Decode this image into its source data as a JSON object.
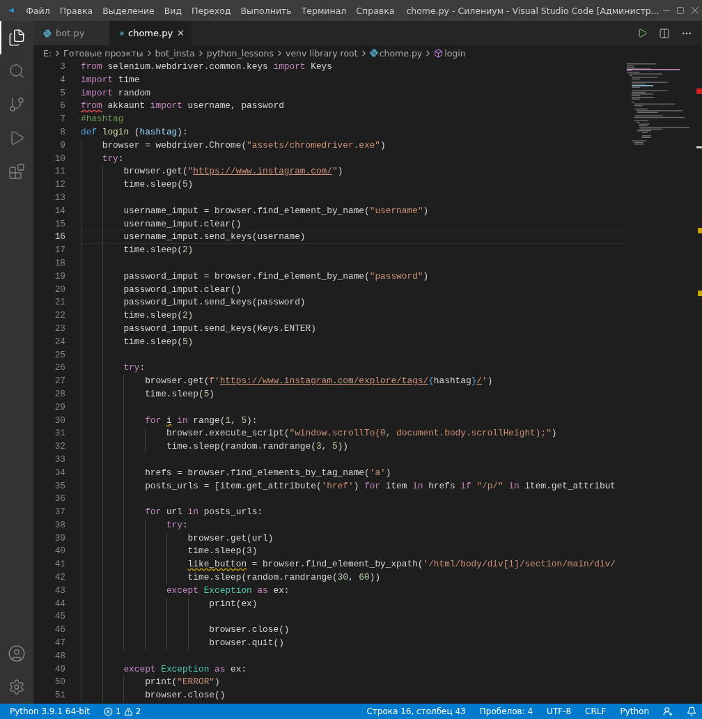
{
  "window": {
    "title": "chome.py - Силениум - Visual Studio Code [Администр..."
  },
  "menu": [
    "Файл",
    "Правка",
    "Выделение",
    "Вид",
    "Переход",
    "Выполнить",
    "Терминал",
    "Справка"
  ],
  "tabs": [
    {
      "label": "bot.py",
      "selected": false
    },
    {
      "label": "chome.py",
      "selected": true,
      "close": "✕"
    }
  ],
  "breadcrumb": [
    {
      "label": "E:",
      "kind": "folder"
    },
    {
      "label": "Готовые проэкты",
      "kind": "folder"
    },
    {
      "label": "bot_insta",
      "kind": "folder"
    },
    {
      "label": "python_lessons",
      "kind": "folder"
    },
    {
      "label": "venv library root",
      "kind": "folder"
    },
    {
      "label": "chome.py",
      "kind": "file"
    },
    {
      "label": "login",
      "kind": "symbol"
    }
  ],
  "lines": [
    {
      "n": "3",
      "current": false,
      "tokens": [
        {
          "t": "from",
          "kind": "keyword"
        },
        {
          "t": " selenium.webdriver.common.keys ",
          "kind": "plain"
        },
        {
          "t": "import",
          "kind": "keyword"
        },
        {
          "t": " Keys",
          "kind": "plain"
        }
      ]
    },
    {
      "n": "4",
      "current": false,
      "tokens": [
        {
          "t": "import",
          "kind": "keyword"
        },
        {
          "t": " time",
          "kind": "plain"
        }
      ]
    },
    {
      "n": "5",
      "current": false,
      "tokens": [
        {
          "t": "import",
          "kind": "keyword"
        },
        {
          "t": " random",
          "kind": "plain"
        }
      ]
    },
    {
      "n": "6",
      "current": false,
      "tokens": [
        {
          "t": "from",
          "kind": "keyword",
          "error": true
        },
        {
          "t": " akkaunt ",
          "kind": "plain"
        },
        {
          "t": "import",
          "kind": "keyword"
        },
        {
          "t": " username, password",
          "kind": "plain"
        }
      ]
    },
    {
      "n": "7",
      "current": false,
      "tokens": [
        {
          "t": "#hashtag",
          "kind": "comment"
        }
      ]
    },
    {
      "n": "8",
      "current": false,
      "tokens": [
        {
          "t": "def",
          "kind": "storage"
        },
        {
          "t": " login",
          "kind": "function"
        },
        {
          "t": " (",
          "kind": "plain"
        },
        {
          "t": "hashtag",
          "kind": "parameter"
        },
        {
          "t": "):",
          "kind": "plain"
        }
      ]
    },
    {
      "n": "9",
      "current": false,
      "tokens": [
        {
          "t": "    browser = webdriver.Chrome(",
          "kind": "plain"
        },
        {
          "t": "\"assets/chromedriver.exe\"",
          "kind": "string"
        },
        {
          "t": ")",
          "kind": "plain"
        }
      ]
    },
    {
      "n": "10",
      "current": false,
      "tokens": [
        {
          "t": "    try",
          "kind": "keyword"
        },
        {
          "t": ":",
          "kind": "plain"
        }
      ]
    },
    {
      "n": "11",
      "current": false,
      "tokens": [
        {
          "t": "        browser.get(",
          "kind": "plain"
        },
        {
          "t": "\"",
          "kind": "string"
        },
        {
          "t": "https://www.instagram.com/",
          "kind": "link"
        },
        {
          "t": "\"",
          "kind": "string"
        },
        {
          "t": ")",
          "kind": "plain"
        }
      ]
    },
    {
      "n": "12",
      "current": false,
      "tokens": [
        {
          "t": "        time.sleep(",
          "kind": "plain"
        },
        {
          "t": "5",
          "kind": "number"
        },
        {
          "t": ")",
          "kind": "plain"
        }
      ]
    },
    {
      "n": "13",
      "current": false
    },
    {
      "n": "14",
      "current": false,
      "tokens": [
        {
          "t": "        username_imput = browser.find_element_by_name(",
          "kind": "plain"
        },
        {
          "t": "\"username\"",
          "kind": "string"
        },
        {
          "t": ")",
          "kind": "plain"
        }
      ]
    },
    {
      "n": "15",
      "current": false,
      "tokens": [
        {
          "t": "        username_imput.clear()",
          "kind": "plain"
        }
      ]
    },
    {
      "n": "16",
      "current": true,
      "tokens": [
        {
          "t": "        username_imput.send_keys(username)",
          "kind": "plain"
        }
      ]
    },
    {
      "n": "17",
      "current": false,
      "tokens": [
        {
          "t": "        time.sleep(",
          "kind": "plain"
        },
        {
          "t": "2",
          "kind": "number"
        },
        {
          "t": ")",
          "kind": "plain"
        }
      ]
    },
    {
      "n": "18",
      "current": false
    },
    {
      "n": "19",
      "current": false,
      "tokens": [
        {
          "t": "        password_imput = browser.find_element_by_name(",
          "kind": "plain"
        },
        {
          "t": "\"password\"",
          "kind": "string"
        },
        {
          "t": ")",
          "kind": "plain"
        }
      ]
    },
    {
      "n": "20",
      "current": false,
      "tokens": [
        {
          "t": "        password_imput.clear()",
          "kind": "plain"
        }
      ]
    },
    {
      "n": "21",
      "current": false,
      "tokens": [
        {
          "t": "        password_imput.send_keys(password)",
          "kind": "plain"
        }
      ]
    },
    {
      "n": "22",
      "current": false,
      "tokens": [
        {
          "t": "        time.sleep(",
          "kind": "plain"
        },
        {
          "t": "2",
          "kind": "number"
        },
        {
          "t": ")",
          "kind": "plain"
        }
      ]
    },
    {
      "n": "23",
      "current": false,
      "tokens": [
        {
          "t": "        password_imput.send_keys(Keys.ENTER)",
          "kind": "plain"
        }
      ]
    },
    {
      "n": "24",
      "current": false,
      "tokens": [
        {
          "t": "        time.sleep(",
          "kind": "plain"
        },
        {
          "t": "5",
          "kind": "number"
        },
        {
          "t": ")",
          "kind": "plain"
        }
      ]
    },
    {
      "n": "25",
      "current": false
    },
    {
      "n": "26",
      "current": false,
      "tokens": [
        {
          "t": "        try",
          "kind": "keyword"
        },
        {
          "t": ":",
          "kind": "plain"
        }
      ]
    },
    {
      "n": "27",
      "current": false,
      "tokens": [
        {
          "t": "            browser.get(",
          "kind": "plain"
        },
        {
          "t": "f'",
          "kind": "string"
        },
        {
          "t": "https://www.instagram.com/explore/tags/",
          "kind": "link"
        },
        {
          "t": "{",
          "kind": "storage"
        },
        {
          "t": "hashtag",
          "kind": "plain"
        },
        {
          "t": "}",
          "kind": "storage"
        },
        {
          "t": "/",
          "kind": "link"
        },
        {
          "t": "'",
          "kind": "string"
        },
        {
          "t": ")",
          "kind": "plain"
        }
      ]
    },
    {
      "n": "28",
      "current": false,
      "tokens": [
        {
          "t": "            time.sleep(",
          "kind": "plain"
        },
        {
          "t": "5",
          "kind": "number"
        },
        {
          "t": ")",
          "kind": "plain"
        }
      ]
    },
    {
      "n": "29",
      "current": false
    },
    {
      "n": "30",
      "current": false,
      "tokens": [
        {
          "t": "            for ",
          "kind": "keyword"
        },
        {
          "t": "i",
          "kind": "plain",
          "warning": true
        },
        {
          "t": " in",
          "kind": "keyword"
        },
        {
          "t": " range(",
          "kind": "plain"
        },
        {
          "t": "1",
          "kind": "number"
        },
        {
          "t": ", ",
          "kind": "plain"
        },
        {
          "t": "5",
          "kind": "number"
        },
        {
          "t": "):",
          "kind": "plain"
        }
      ]
    },
    {
      "n": "31",
      "current": false,
      "tokens": [
        {
          "t": "                browser.execute_script(",
          "kind": "plain"
        },
        {
          "t": "\"window.scrollTo(0, document.body.scrollHeight);\"",
          "kind": "string"
        },
        {
          "t": ")",
          "kind": "plain"
        }
      ]
    },
    {
      "n": "32",
      "current": false,
      "tokens": [
        {
          "t": "                time.sleep(random.randrange(",
          "kind": "plain"
        },
        {
          "t": "3",
          "kind": "number"
        },
        {
          "t": ", ",
          "kind": "plain"
        },
        {
          "t": "5",
          "kind": "number"
        },
        {
          "t": "))",
          "kind": "plain"
        }
      ]
    },
    {
      "n": "33",
      "current": false
    },
    {
      "n": "34",
      "current": false,
      "tokens": [
        {
          "t": "            hrefs = browser.find_elements_by_tag_name(",
          "kind": "plain"
        },
        {
          "t": "'a'",
          "kind": "string"
        },
        {
          "t": ")",
          "kind": "plain"
        }
      ]
    },
    {
      "n": "35",
      "current": false,
      "tokens": [
        {
          "t": "            posts_urls = [item.get_attribute(",
          "kind": "plain"
        },
        {
          "t": "'href'",
          "kind": "string"
        },
        {
          "t": ") ",
          "kind": "plain"
        },
        {
          "t": "for",
          "kind": "keyword"
        },
        {
          "t": " item ",
          "kind": "plain"
        },
        {
          "t": "in",
          "kind": "keyword"
        },
        {
          "t": " hrefs ",
          "kind": "plain"
        },
        {
          "t": "if ",
          "kind": "keyword"
        },
        {
          "t": "\"/p/\"",
          "kind": "string"
        },
        {
          "t": " in",
          "kind": "keyword"
        },
        {
          "t": " item.get_attribut",
          "kind": "plain"
        }
      ]
    },
    {
      "n": "36",
      "current": false
    },
    {
      "n": "37",
      "current": false,
      "tokens": [
        {
          "t": "            for",
          "kind": "keyword"
        },
        {
          "t": " url ",
          "kind": "plain"
        },
        {
          "t": "in",
          "kind": "keyword"
        },
        {
          "t": " posts_urls:",
          "kind": "plain"
        }
      ]
    },
    {
      "n": "38",
      "current": false,
      "tokens": [
        {
          "t": "                try",
          "kind": "keyword"
        },
        {
          "t": ":",
          "kind": "plain"
        }
      ]
    },
    {
      "n": "39",
      "current": false,
      "tokens": [
        {
          "t": "                    browser.get(url)",
          "kind": "plain"
        }
      ]
    },
    {
      "n": "40",
      "current": false,
      "tokens": [
        {
          "t": "                    time.sleep(",
          "kind": "plain"
        },
        {
          "t": "3",
          "kind": "number"
        },
        {
          "t": ")",
          "kind": "plain"
        }
      ]
    },
    {
      "n": "41",
      "current": false,
      "tokens": [
        {
          "t": "                    like_button",
          "kind": "plain",
          "warning": true
        },
        {
          "t": " = browser.find_element_by_xpath(",
          "kind": "plain"
        },
        {
          "t": "'/html/body/div[1]/section/main/div/",
          "kind": "string"
        }
      ]
    },
    {
      "n": "42",
      "current": false,
      "tokens": [
        {
          "t": "                    time.sleep(random.randrange(",
          "kind": "plain"
        },
        {
          "t": "30",
          "kind": "number"
        },
        {
          "t": ", ",
          "kind": "plain"
        },
        {
          "t": "60",
          "kind": "number"
        },
        {
          "t": "))",
          "kind": "plain"
        }
      ]
    },
    {
      "n": "43",
      "current": false,
      "tokens": [
        {
          "t": "                except ",
          "kind": "keyword"
        },
        {
          "t": "Exception",
          "kind": "class"
        },
        {
          "t": " as",
          "kind": "keyword"
        },
        {
          "t": " ex:",
          "kind": "plain"
        }
      ]
    },
    {
      "n": "44",
      "current": false,
      "tokens": [
        {
          "t": "                        print(ex)",
          "kind": "plain"
        }
      ]
    },
    {
      "n": "45",
      "current": false
    },
    {
      "n": "46",
      "current": false,
      "tokens": [
        {
          "t": "                        browser.close()",
          "kind": "plain"
        }
      ]
    },
    {
      "n": "47",
      "current": false,
      "tokens": [
        {
          "t": "                        browser.quit()",
          "kind": "plain"
        }
      ]
    },
    {
      "n": "48",
      "current": false
    },
    {
      "n": "49",
      "current": false,
      "tokens": [
        {
          "t": "        except ",
          "kind": "keyword"
        },
        {
          "t": "Exception",
          "kind": "class"
        },
        {
          "t": " as",
          "kind": "keyword"
        },
        {
          "t": " ex:",
          "kind": "plain"
        }
      ]
    },
    {
      "n": "50",
      "current": false,
      "tokens": [
        {
          "t": "            print(",
          "kind": "plain"
        },
        {
          "t": "\"ERROR\"",
          "kind": "string"
        },
        {
          "t": ")",
          "kind": "plain"
        }
      ]
    },
    {
      "n": "51",
      "current": false,
      "tokens": [
        {
          "t": "            browser.close()",
          "kind": "plain"
        }
      ]
    }
  ],
  "status_bar": {
    "interpreter": "Python 3.9.1 64-bit",
    "errors": "1",
    "warnings": "2",
    "right": [
      "Строка 16, столбец 43",
      "Пробелов: 4",
      "UTF-8",
      "CRLF",
      "Python"
    ]
  }
}
